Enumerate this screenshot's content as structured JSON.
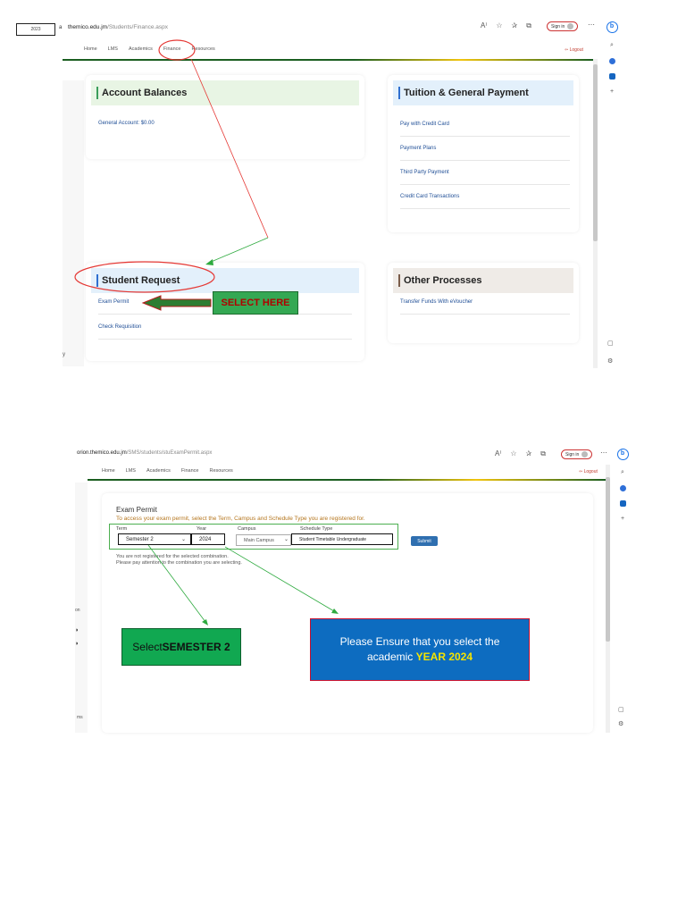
{
  "shot1": {
    "tab_label": "2023",
    "addr_sep": "a",
    "url_visible": "themico.edu.jm",
    "url_path": "/Students/Finance.aspx",
    "sign_in": "Sign in",
    "nav": [
      "Home",
      "LMS",
      "Academics",
      "Finance",
      "Resources"
    ],
    "logout": "Logout",
    "cards": {
      "account_balances": {
        "title": "Account Balances",
        "links": [
          "General Account: $0.00"
        ]
      },
      "tuition": {
        "title": "Tuition & General Payment",
        "links": [
          "Pay with Credit Card",
          "Payment Plans",
          "Third Party Payment",
          "Credit Card Transactions"
        ]
      },
      "student_request": {
        "title": "Student Request",
        "links": [
          "Exam Permit",
          "Check Requisition"
        ]
      },
      "other": {
        "title": "Other Processes",
        "links": [
          "Transfer Funds With eVoucher"
        ]
      }
    },
    "callout": "SELECT HERE",
    "left_edge_char": "y"
  },
  "shot2": {
    "url_visible": "orion.themico.edu.jm",
    "url_path": "/SMS/students/stuExamPermit.aspx",
    "sign_in": "Sign in",
    "nav": [
      "Home",
      "LMS",
      "Academics",
      "Finance",
      "Resources"
    ],
    "logout": "Logout",
    "form": {
      "title": "Exam Permit",
      "subtitle": "To access your exam permit, select the Term, Campus and Schedule Type you are registered for.",
      "labels": {
        "term": "Term",
        "year": "Year",
        "campus": "Campus",
        "schedule": "Schedule Type"
      },
      "values": {
        "term": "Semester 2",
        "year": "2024",
        "campus": "Main Campus",
        "schedule": "Student Timetable Undergraduate"
      },
      "submit": "Submit",
      "messages": [
        "You are not registered for the selected combination.",
        "Please pay attention to the combination you are selecting."
      ]
    },
    "callout_semester": {
      "prefix": "Select ",
      "bold": "SEMESTER 2"
    },
    "callout_year": {
      "line1": "Please Ensure that you select the",
      "line2_prefix": "academic ",
      "line2_highlight": "YEAR 2024"
    },
    "left_edge_text": "on",
    "left_edge_text2": "ms"
  },
  "colors": {
    "callout_green": "#34a853",
    "callout_red_text": "#b00000",
    "year_box_blue": "#0d6cc0",
    "year_highlight": "#f5e400",
    "link_blue": "#1f4e96",
    "annotation_red": "#e53935",
    "annotation_green": "#2eaa3f"
  }
}
